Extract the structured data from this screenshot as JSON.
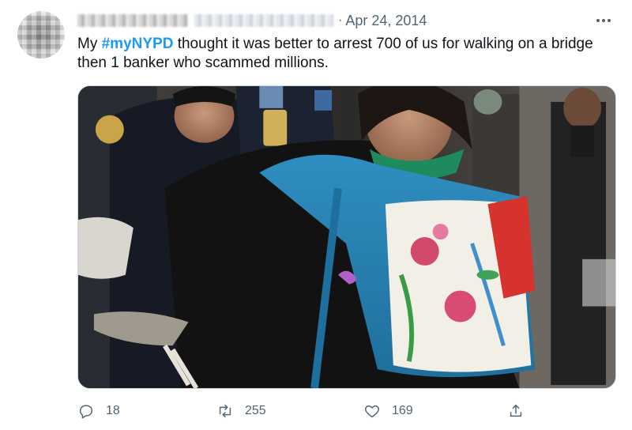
{
  "tweet": {
    "date_separator": "·",
    "date": "Apr 24, 2014",
    "text_before": "My ",
    "hashtag": "#myNYPD",
    "text_after": " thought it was better to arrest 700 of us for walking on a bridge then 1 banker who scammed millions."
  },
  "actions": {
    "reply_count": "18",
    "retweet_count": "255",
    "like_count": "169"
  },
  "colors": {
    "link": "#1d9bf0",
    "secondary_text": "#536471",
    "border": "#cfd9de"
  },
  "icons": {
    "more": "more-icon",
    "reply": "reply-icon",
    "retweet": "retweet-icon",
    "like": "heart-icon",
    "share": "share-icon"
  }
}
